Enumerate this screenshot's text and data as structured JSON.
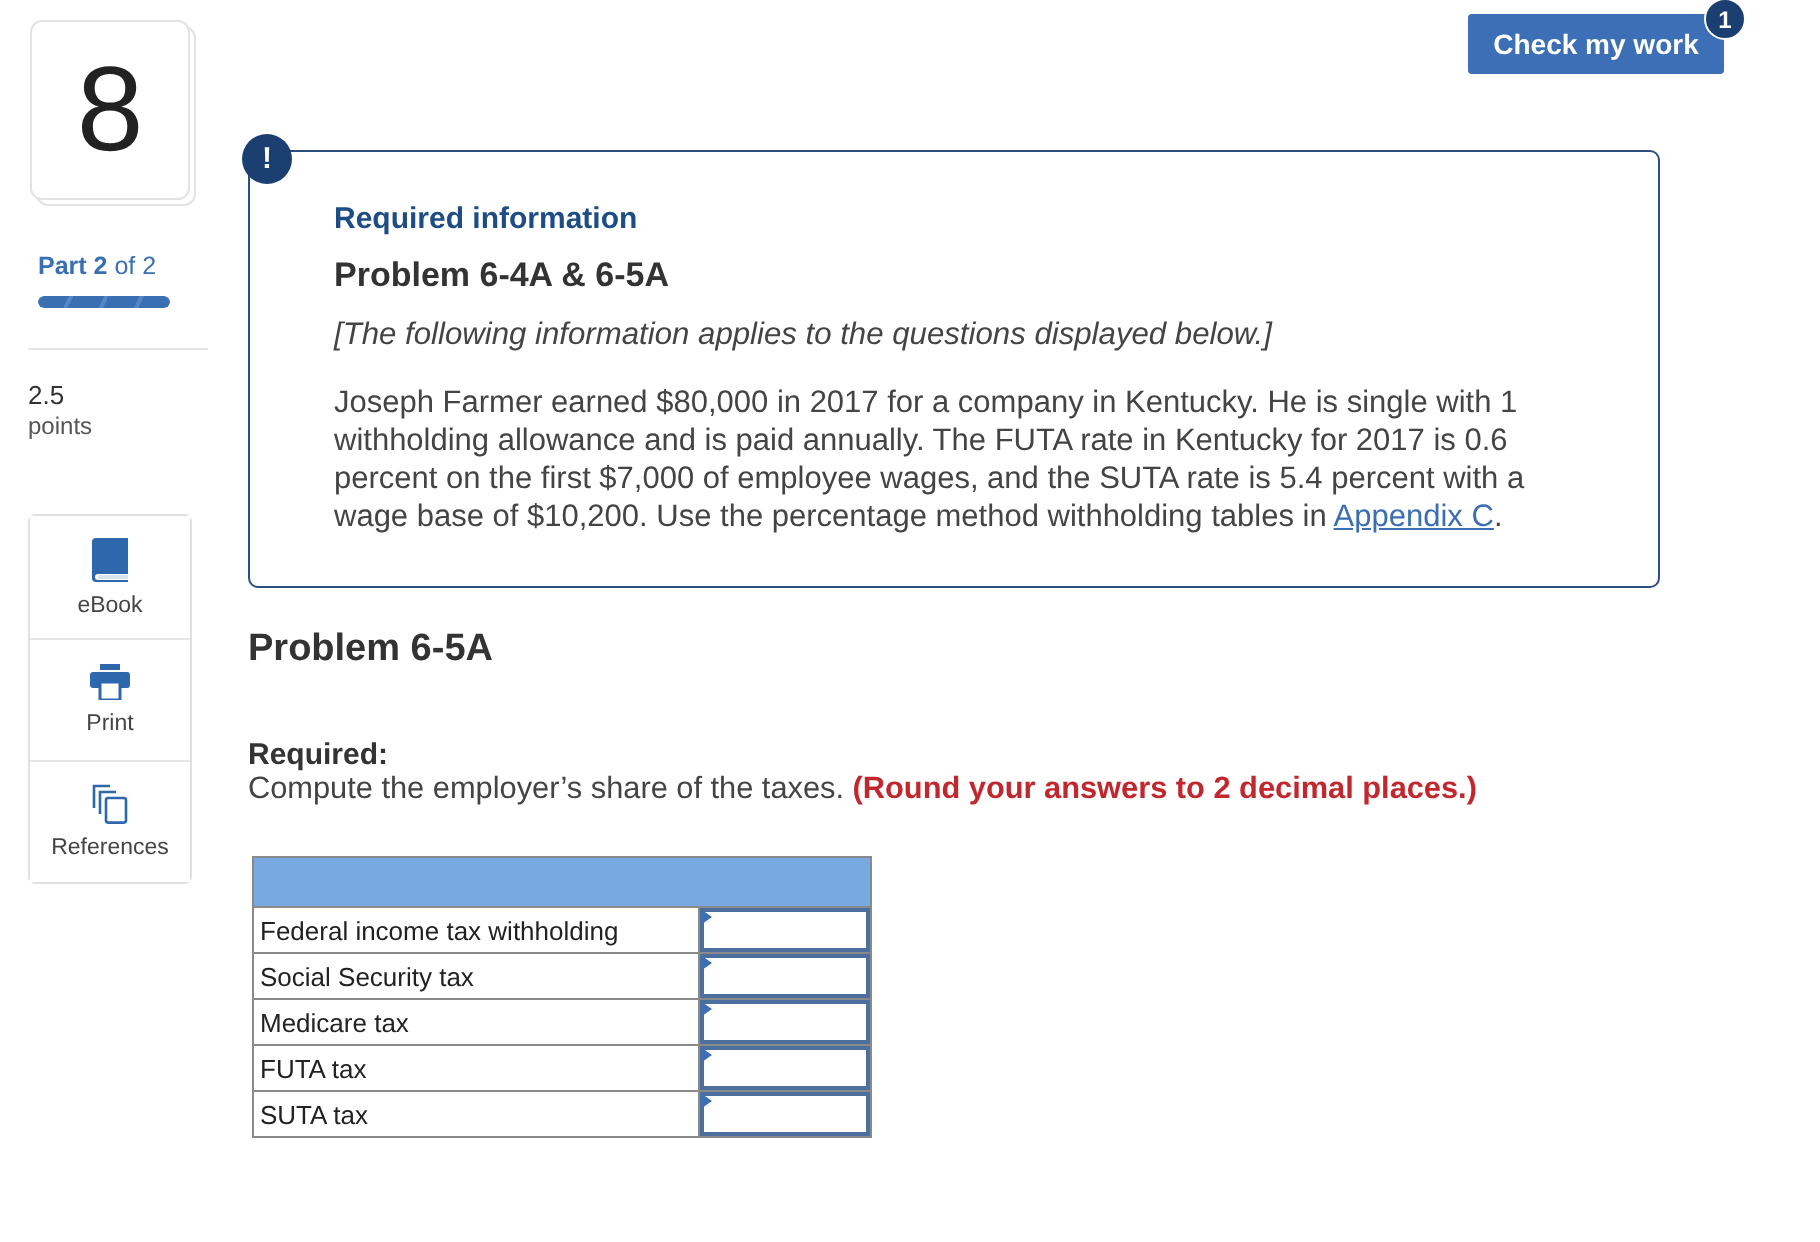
{
  "header": {
    "check_button": "Check my work",
    "badge": "1"
  },
  "sidebar": {
    "question_number": "8",
    "part": "**Part 2** of 2",
    "progress": {
      "level": 1
    },
    "points_value": "2.5",
    "points_label": "points",
    "tools": [
      {
        "kind": "ebook",
        "label": "eBook"
      },
      {
        "kind": "print",
        "label": "Print"
      },
      {
        "kind": "references",
        "label": "References"
      }
    ]
  },
  "info": {
    "badge": "!",
    "heading": "Required information",
    "title": "Problem 6-4A & 6-5A",
    "note": "[The following information applies to the questions displayed below.]",
    "body": "Joseph Farmer earned $80,000 in 2017 for a company in Kentucky. He is single with 1 withholding allowance and is paid annually. The FUTA rate in Kentucky for 2017 is 0.6 percent on the first $7,000 of employee wages, and the SUTA rate is 5.4 percent with a wage base of $10,200. Use the percentage method withholding tables in",
    "link": "Appendix C",
    "body_end": "."
  },
  "problem": {
    "title": "Problem 6-5A",
    "required_label": "Required:",
    "instruction": "Compute the employer’s share of the taxes. **(Round your answers to 2 decimal places.)**"
  },
  "table": {
    "rows": [
      {
        "label": "Federal income tax withholding"
      },
      {
        "label": "Social Security tax"
      },
      {
        "label": "Medicare tax"
      },
      {
        "label": "FUTA tax"
      },
      {
        "label": "SUTA tax"
      }
    ]
  }
}
